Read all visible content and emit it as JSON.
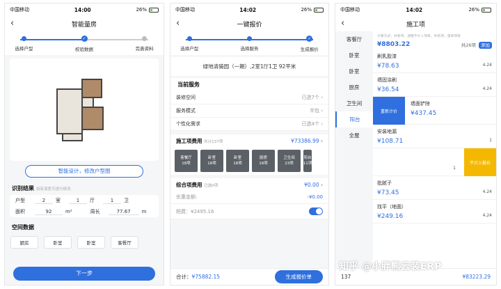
{
  "status": {
    "carrier": "中国移动",
    "battery": "26%",
    "p1_time": "14:00",
    "p2_time": "14:02",
    "p3_time": "14:02"
  },
  "p1": {
    "title": "智能量房",
    "steps": [
      "选择户型",
      "校验数据",
      "完善资料"
    ],
    "design_button": "智能设计，修改户型图",
    "recog_title": "识别结果",
    "recog_hint": "如有误差可进行修改",
    "huxing_label": "户型",
    "shi_val": "2",
    "shi_unit": "室",
    "ting_val": "1",
    "ting_unit": "厅",
    "wei_val": "1",
    "wei_unit": "卫",
    "area_label": "面积",
    "area_val": "92",
    "area_unit": "m²",
    "perim_label": "周长",
    "perim_val": "77.67",
    "perim_unit": "m",
    "space_title": "空间数据",
    "spaces": [
      "厨房",
      "卧室",
      "卧室",
      "客餐厅"
    ],
    "next": "下一步"
  },
  "p2": {
    "title": "一键报价",
    "steps": [
      "选择户型",
      "选择服务",
      "生成报价"
    ],
    "address": "绿地清猗园（一期）,2室1厅1卫 92平米",
    "current_service": "当前服务",
    "services": [
      {
        "label": "装修空间",
        "value": "已选7个"
      },
      {
        "label": "服务模式",
        "value": "半包"
      },
      {
        "label": "个性化需求",
        "value": "已选4个"
      }
    ],
    "construction_label": "施工项费用",
    "construction_count": "共计137项",
    "construction_total": "¥73386.99",
    "thumbs": [
      "客餐厅\n18项",
      "卧室\n18项",
      "卧室\n18项",
      "厨房\n18项",
      "卫生间\n23项",
      "阳台\n11项"
    ],
    "combined_label": "综合项费用",
    "combined_count": "已选0项",
    "combined_total": "¥0.00",
    "discount_label": "优惠金额:",
    "discount_val": "-¥0.00",
    "tax_label": "税费：",
    "tax_val": "¥2495.16",
    "total_label": "合计：",
    "total_val": "¥75882.15",
    "generate": "生成报价单"
  },
  "p3": {
    "title": "施工项",
    "sidebar": [
      "客餐厅",
      "卧室",
      "卧室",
      "厨房",
      "卫生间",
      "阳台",
      "全屋"
    ],
    "note": "计算方式：共有项，调整不计入项目，共有项，量单项目",
    "total": "¥8803.22",
    "count": "共26项",
    "add": "添加",
    "items": [
      {
        "name": "刷乳胶漆",
        "price": "¥78.63",
        "qty": "4.24"
      },
      {
        "name": "墙固涂刷",
        "price": "¥36.54",
        "qty": "4.24"
      },
      {
        "name": "墙面铲除",
        "price": "¥437.45",
        "qty": ""
      },
      {
        "name": "安装地漏",
        "price": "¥108.71",
        "qty": "1"
      },
      {
        "name": "",
        "price": "",
        "qty": "1"
      },
      {
        "name": "批腻子",
        "price": "¥73.45",
        "qty": "4.24"
      },
      {
        "name": "找平（地面）",
        "price": "¥249.16",
        "qty": "4.24"
      }
    ],
    "recalc": "重新计价",
    "exclude": "不计入报价",
    "footer_total": "¥83223.29",
    "footer_count": "137"
  },
  "watermark": "知乎 @小胖熊云装ERP"
}
